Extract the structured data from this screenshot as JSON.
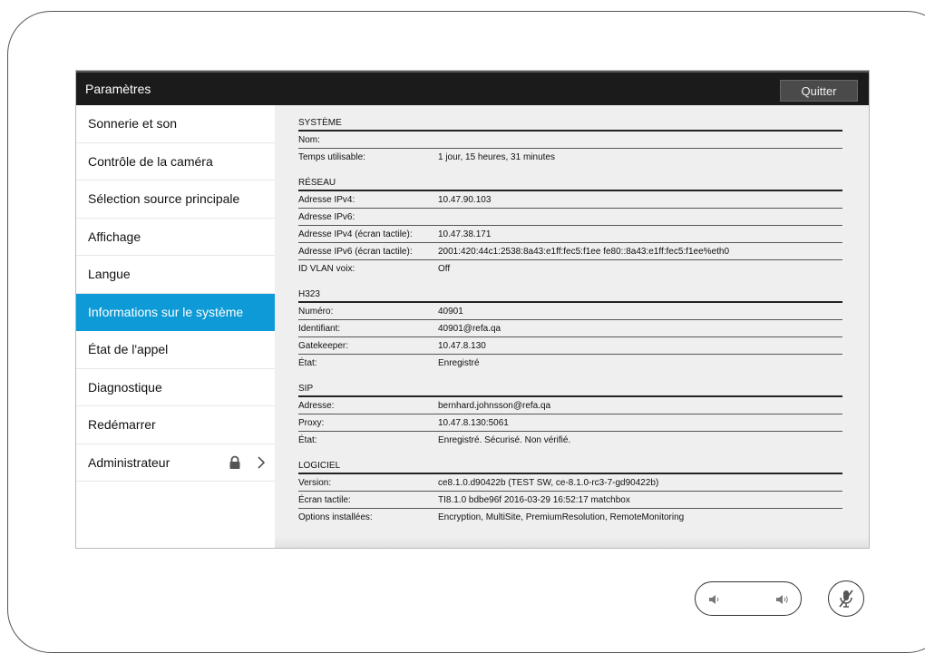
{
  "window": {
    "title": "Paramètres",
    "quit_label": "Quitter"
  },
  "sidebar": {
    "items": [
      {
        "label": "Sonnerie et son"
      },
      {
        "label": "Contrôle de la caméra"
      },
      {
        "label": "Sélection source principale"
      },
      {
        "label": "Affichage"
      },
      {
        "label": "Langue"
      },
      {
        "label": "Informations sur le système",
        "active": true
      },
      {
        "label": "État de l'appel"
      },
      {
        "label": "Diagnostique"
      },
      {
        "label": "Redémarrer"
      },
      {
        "label": "Administrateur",
        "locked": true
      }
    ]
  },
  "sections": {
    "systeme": {
      "header": "SYSTÈME",
      "rows": [
        {
          "key": "Nom:",
          "value": ""
        },
        {
          "key": "Temps utilisable:",
          "value": "1 jour, 15 heures, 31 minutes"
        }
      ]
    },
    "reseau": {
      "header": "RÉSEAU",
      "rows": [
        {
          "key": "Adresse IPv4:",
          "value": "10.47.90.103"
        },
        {
          "key": "Adresse IPv6:",
          "value": ""
        },
        {
          "key": "Adresse IPv4 (écran tactile):",
          "value": "10.47.38.171"
        },
        {
          "key": "Adresse IPv6 (écran tactile):",
          "value": "2001:420:44c1:2538:8a43:e1ff:fec5:f1ee fe80::8a43:e1ff:fec5:f1ee%eth0"
        },
        {
          "key": "ID VLAN voix:",
          "value": "Off"
        }
      ]
    },
    "h323": {
      "header": "H323",
      "rows": [
        {
          "key": "Numéro:",
          "value": "40901"
        },
        {
          "key": "Identifiant:",
          "value": "40901@refa.qa"
        },
        {
          "key": "Gatekeeper:",
          "value": "10.47.8.130"
        },
        {
          "key": "État:",
          "value": "Enregistré"
        }
      ]
    },
    "sip": {
      "header": "SIP",
      "rows": [
        {
          "key": "Adresse:",
          "value": "bernhard.johnsson@refa.qa"
        },
        {
          "key": "Proxy:",
          "value": "10.47.8.130:5061"
        },
        {
          "key": "État:",
          "value": "Enregistré. Sécurisé. Non vérifié."
        }
      ]
    },
    "logiciel": {
      "header": "LOGICIEL",
      "rows": [
        {
          "key": "Version:",
          "value": "ce8.1.0.d90422b (TEST SW, ce-8.1.0-rc3-7-gd90422b)"
        },
        {
          "key": "Écran tactile:",
          "value": "TI8.1.0 bdbe96f 2016-03-29 16:52:17 matchbox"
        },
        {
          "key": "Options installées:",
          "value": "Encryption, MultiSite, PremiumResolution, RemoteMonitoring"
        }
      ]
    }
  },
  "icons": {
    "lock": "lock-icon",
    "chevron": "chevron-right-icon",
    "volume_down": "volume-down-icon",
    "volume_up": "volume-up-icon",
    "mute": "microphone-muted-icon"
  },
  "colors": {
    "accent": "#0d9ad6",
    "titlebar": "#1b1b1b",
    "content_bg": "#efefef"
  }
}
